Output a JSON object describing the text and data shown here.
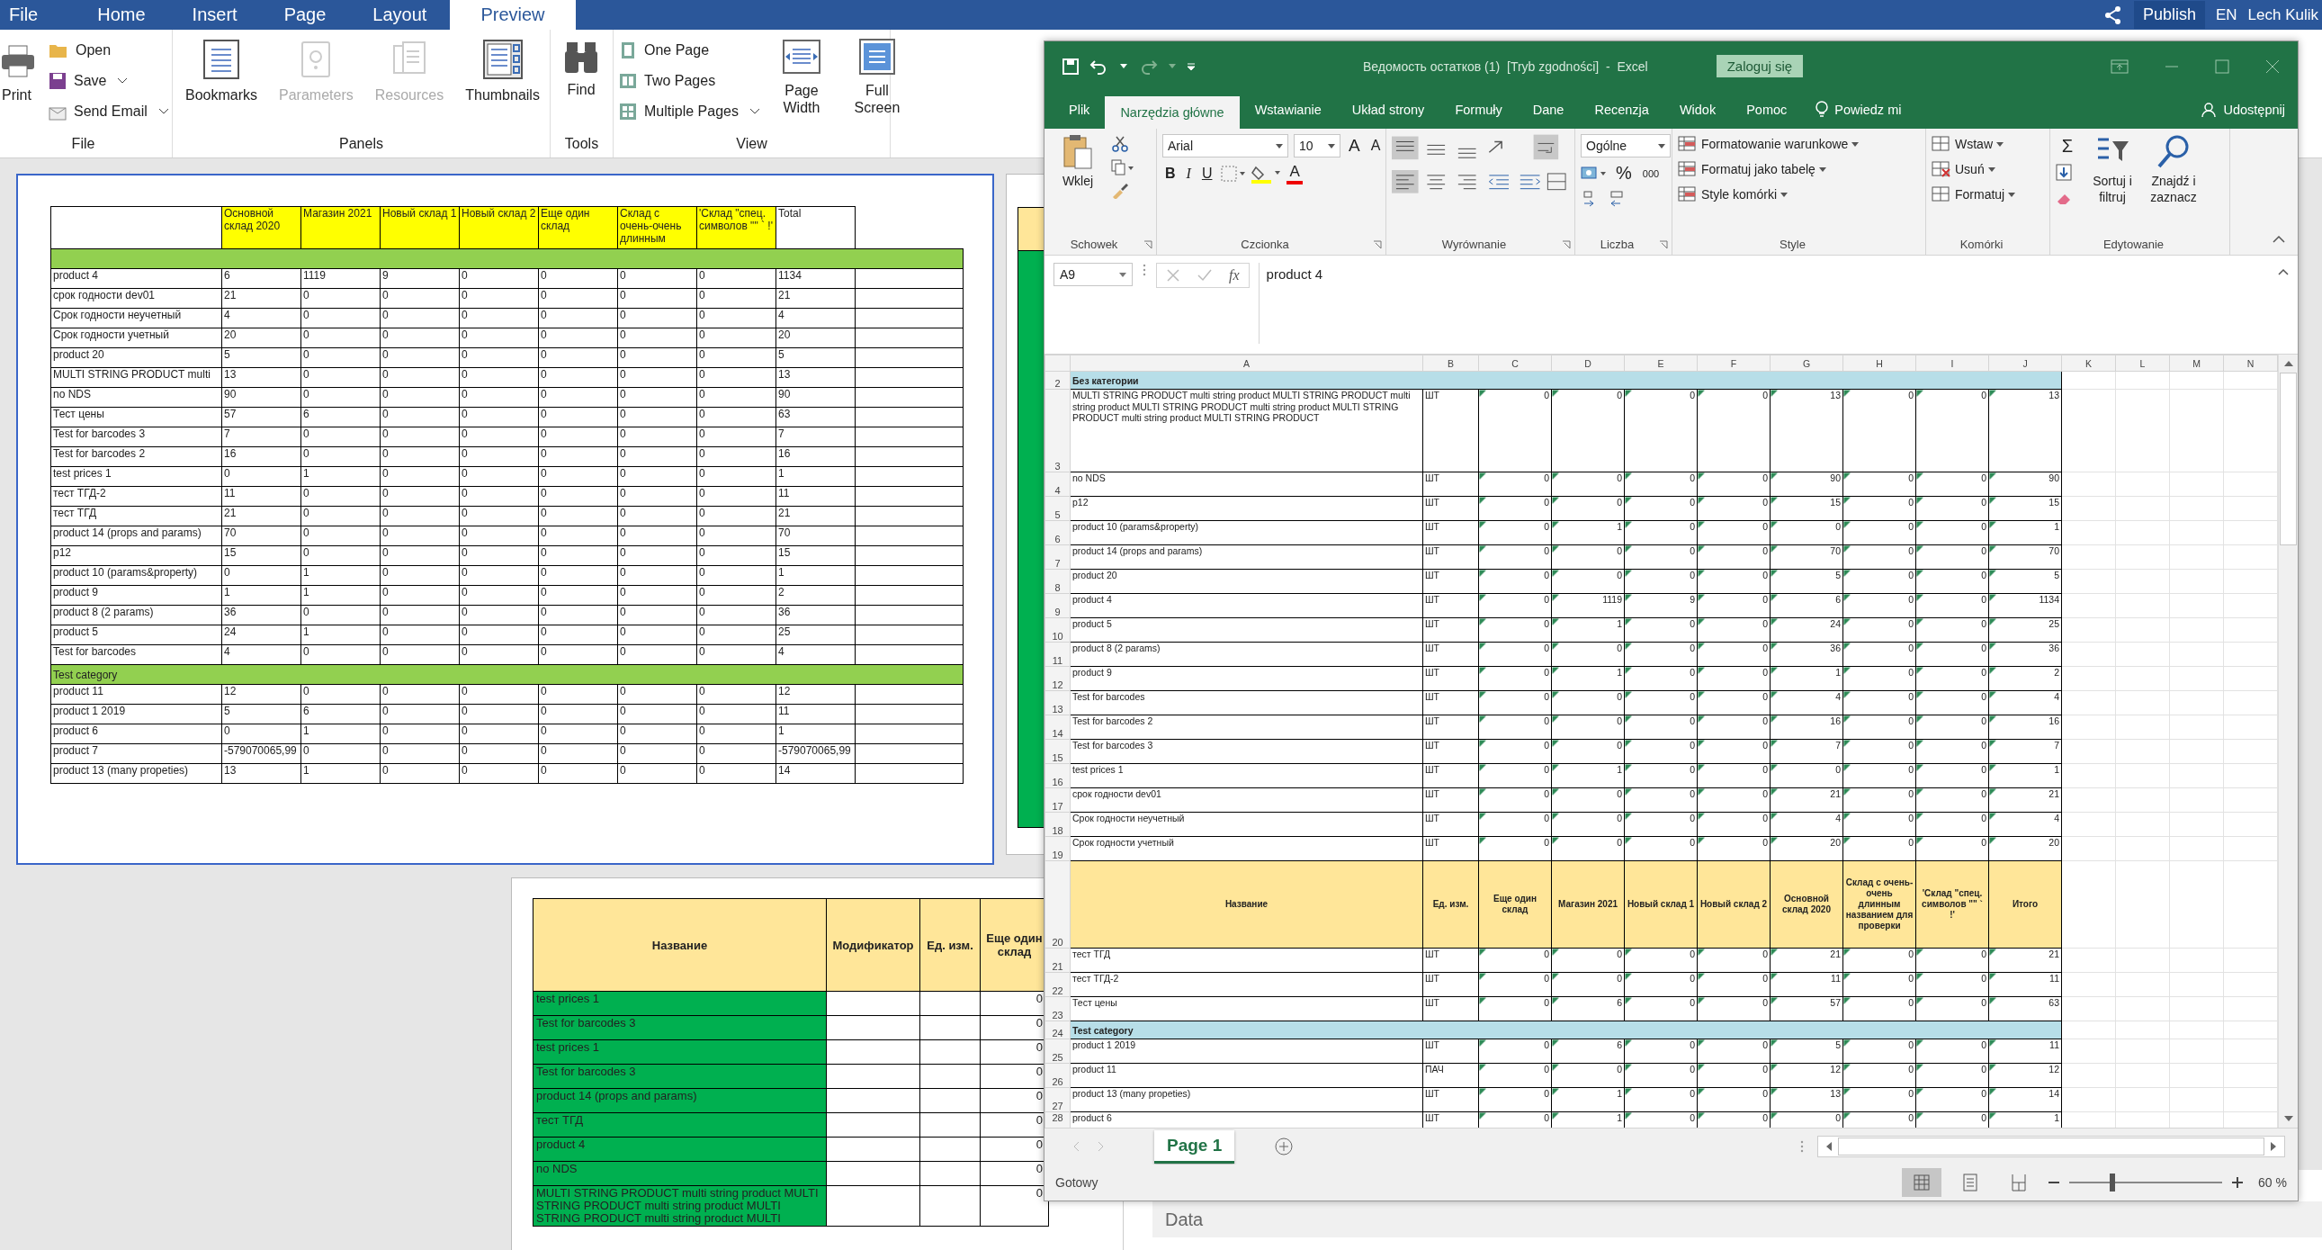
{
  "viewer": {
    "tabs": [
      {
        "label": "File",
        "selected": false
      },
      {
        "label": "Home",
        "selected": false
      },
      {
        "label": "Insert",
        "selected": false
      },
      {
        "label": "Page",
        "selected": false
      },
      {
        "label": "Layout",
        "selected": false
      },
      {
        "label": "Preview",
        "selected": true
      }
    ],
    "publish": "Publish",
    "language": "EN",
    "user": "Lech Kulik",
    "ribbon": {
      "file": {
        "title": "File",
        "print": "Print",
        "open": "Open",
        "save": "Save",
        "send_email": "Send Email"
      },
      "panels": {
        "title": "Panels",
        "items": [
          {
            "label": "Bookmarks",
            "disabled": false
          },
          {
            "label": "Parameters",
            "disabled": true
          },
          {
            "label": "Resources",
            "disabled": true
          },
          {
            "label": "Thumbnails",
            "disabled": false
          }
        ]
      },
      "tools": {
        "title": "Tools",
        "find": "Find"
      },
      "view": {
        "title": "View",
        "one_page": "One Page",
        "two_pages": "Two Pages",
        "multiple_pages": "Multiple Pages",
        "page_width": "Page Width",
        "full_screen": "Full Screen"
      }
    }
  },
  "report_page": {
    "columns": [
      "Основной склад 2020",
      "Магазин 2021",
      "Новый склад 1",
      "Новый склад 2",
      "Еще один склад",
      "Склад с очень-очень длинным",
      "'Склад \"спец. символов \"\" ` !'",
      "Total"
    ],
    "groups": [
      {
        "rows": [
          {
            "name": "product 4",
            "values": [
              "6",
              "1119",
              "9",
              "0",
              "0",
              "0",
              "0",
              "1134"
            ]
          },
          {
            "name": "срок годности dev01",
            "values": [
              "21",
              "0",
              "0",
              "0",
              "0",
              "0",
              "0",
              "21"
            ]
          },
          {
            "name": "Срок годности неучетный",
            "values": [
              "4",
              "0",
              "0",
              "0",
              "0",
              "0",
              "0",
              "4"
            ]
          },
          {
            "name": "Срок годности учетный",
            "values": [
              "20",
              "0",
              "0",
              "0",
              "0",
              "0",
              "0",
              "20"
            ]
          },
          {
            "name": "product 20",
            "values": [
              "5",
              "0",
              "0",
              "0",
              "0",
              "0",
              "0",
              "5"
            ]
          },
          {
            "name": "MULTI  STRING  PRODUCT  multi",
            "values": [
              "13",
              "0",
              "0",
              "0",
              "0",
              "0",
              "0",
              "13"
            ]
          },
          {
            "name": "no NDS",
            "values": [
              "90",
              "0",
              "0",
              "0",
              "0",
              "0",
              "0",
              "90"
            ]
          },
          {
            "name": "Тест цены",
            "values": [
              "57",
              "6",
              "0",
              "0",
              "0",
              "0",
              "0",
              "63"
            ]
          },
          {
            "name": "Test for barcodes 3",
            "values": [
              "7",
              "0",
              "0",
              "0",
              "0",
              "0",
              "0",
              "7"
            ]
          },
          {
            "name": "Test for barcodes 2",
            "values": [
              "16",
              "0",
              "0",
              "0",
              "0",
              "0",
              "0",
              "16"
            ]
          },
          {
            "name": "test prices 1",
            "values": [
              "0",
              "1",
              "0",
              "0",
              "0",
              "0",
              "0",
              "1"
            ]
          },
          {
            "name": "тест ТГД-2",
            "values": [
              "11",
              "0",
              "0",
              "0",
              "0",
              "0",
              "0",
              "11"
            ]
          },
          {
            "name": "тест ТГД",
            "values": [
              "21",
              "0",
              "0",
              "0",
              "0",
              "0",
              "0",
              "21"
            ]
          },
          {
            "name": "product 14 (props and params)",
            "values": [
              "70",
              "0",
              "0",
              "0",
              "0",
              "0",
              "0",
              "70"
            ]
          },
          {
            "name": "p12",
            "values": [
              "15",
              "0",
              "0",
              "0",
              "0",
              "0",
              "0",
              "15"
            ]
          },
          {
            "name": "product 10 (params&property)",
            "values": [
              "0",
              "1",
              "0",
              "0",
              "0",
              "0",
              "0",
              "1"
            ]
          },
          {
            "name": "product 9",
            "values": [
              "1",
              "1",
              "0",
              "0",
              "0",
              "0",
              "0",
              "2"
            ]
          },
          {
            "name": "product 8 (2 params)",
            "values": [
              "36",
              "0",
              "0",
              "0",
              "0",
              "0",
              "0",
              "36"
            ]
          },
          {
            "name": "product 5",
            "values": [
              "24",
              "1",
              "0",
              "0",
              "0",
              "0",
              "0",
              "25"
            ]
          },
          {
            "name": "Test for barcodes",
            "values": [
              "4",
              "0",
              "0",
              "0",
              "0",
              "0",
              "0",
              "4"
            ]
          }
        ]
      },
      {
        "title": "Test category",
        "rows": [
          {
            "name": "product 11",
            "values": [
              "12",
              "0",
              "0",
              "0",
              "0",
              "0",
              "0",
              "12"
            ]
          },
          {
            "name": "product 1 2019",
            "values": [
              "5",
              "6",
              "0",
              "0",
              "0",
              "0",
              "0",
              "11"
            ]
          },
          {
            "name": "product 6",
            "values": [
              "0",
              "1",
              "0",
              "0",
              "0",
              "0",
              "0",
              "1"
            ]
          },
          {
            "name": "product 7",
            "values": [
              "-579070065,99",
              "0",
              "0",
              "0",
              "0",
              "0",
              "0",
              "-579070065,99"
            ]
          },
          {
            "name": "product 13 (many propeties)",
            "values": [
              "13",
              "1",
              "0",
              "0",
              "0",
              "0",
              "0",
              "14"
            ]
          }
        ]
      }
    ]
  },
  "lower_page": {
    "columns": [
      "Название",
      "Модификатор",
      "Ед. изм.",
      "Еще один склад"
    ],
    "rows": [
      {
        "name": "test prices 1",
        "value": "0"
      },
      {
        "name": "Test for barcodes 3",
        "value": "0"
      },
      {
        "name": "test prices 1",
        "value": "0"
      },
      {
        "name": "Test for barcodes 3",
        "value": "0"
      },
      {
        "name": "product 14 (props and params)",
        "value": "0"
      },
      {
        "name": "тест ТГД",
        "value": "0"
      },
      {
        "name": "product 4",
        "value": "0"
      },
      {
        "name": "no NDS",
        "value": "0"
      },
      {
        "name": "MULTI STRING PRODUCT multi string product MULTI STRING PRODUCT multi string product MULTI STRING PRODUCT multi string product MULTI",
        "value": "0"
      }
    ]
  },
  "excel": {
    "title": "Ведомость остатков (1)  [Tryb zgodności]  -  Excel",
    "sign_in": "Zaloguj się",
    "tabs": [
      {
        "label": "Plik",
        "selected": false
      },
      {
        "label": "Narzędzia główne",
        "selected": true
      },
      {
        "label": "Wstawianie",
        "selected": false
      },
      {
        "label": "Układ strony",
        "selected": false
      },
      {
        "label": "Formuły",
        "selected": false
      },
      {
        "label": "Dane",
        "selected": false
      },
      {
        "label": "Recenzja",
        "selected": false
      },
      {
        "label": "Widok",
        "selected": false
      },
      {
        "label": "Pomoc",
        "selected": false
      }
    ],
    "tell_me": "Powiedz mi",
    "share": "Udostępnij",
    "ribbon": {
      "clipboard": {
        "title": "Schowek",
        "paste": "Wklej"
      },
      "font": {
        "title": "Czcionka",
        "name": "Arial",
        "size": "10",
        "grow": "A",
        "shrink": "A",
        "bold": "B",
        "italic": "I",
        "underline": "U",
        "font_color_button": "A"
      },
      "alignment": {
        "title": "Wyrównanie"
      },
      "number": {
        "title": "Liczba",
        "format": "Ogólne",
        "percent": "%",
        "thousands": "000"
      },
      "styles": {
        "title": "Style",
        "items": [
          "Formatowanie warunkowe",
          "Formatuj jako tabelę",
          "Style komórki"
        ]
      },
      "cells": {
        "title": "Komórki",
        "items": [
          "Wstaw",
          "Usuń",
          "Formatuj"
        ]
      },
      "editing": {
        "title": "Edytowanie",
        "sum": "Σ",
        "sort": "Sortuj i filtruj",
        "find": "Znajdź i zaznacz"
      }
    },
    "name_box": "A9",
    "fx": "fx",
    "formula": "product 4",
    "columns": [
      "A",
      "B",
      "C",
      "D",
      "E",
      "F",
      "G",
      "H",
      "I",
      "J",
      "K",
      "L",
      "M",
      "N"
    ],
    "rows": [
      {
        "kind": "category",
        "number": "2",
        "label": "Без категории"
      },
      {
        "kind": "item",
        "number": "3",
        "tall": true,
        "name": "MULTI STRING PRODUCT multi string product MULTI STRING PRODUCT multi string product MULTI STRING PRODUCT multi string product MULTI STRING PRODUCT multi string product MULTI STRING PRODUCT",
        "unit": "ШТ",
        "values": [
          "0",
          "0",
          "0",
          "0",
          "13",
          "0",
          "0",
          "13"
        ]
      },
      {
        "kind": "item",
        "number": "4",
        "name": "no NDS",
        "unit": "ШТ",
        "values": [
          "0",
          "0",
          "0",
          "0",
          "90",
          "0",
          "0",
          "90"
        ]
      },
      {
        "kind": "item",
        "number": "5",
        "name": "p12",
        "unit": "ШТ",
        "values": [
          "0",
          "0",
          "0",
          "0",
          "15",
          "0",
          "0",
          "15"
        ]
      },
      {
        "kind": "item",
        "number": "6",
        "name": "product 10 (params&property)",
        "unit": "ШТ",
        "values": [
          "0",
          "1",
          "0",
          "0",
          "0",
          "0",
          "0",
          "1"
        ]
      },
      {
        "kind": "item",
        "number": "7",
        "name": "product 14 (props and params)",
        "unit": "ШТ",
        "values": [
          "0",
          "0",
          "0",
          "0",
          "70",
          "0",
          "0",
          "70"
        ]
      },
      {
        "kind": "item",
        "number": "8",
        "name": "product 20",
        "unit": "ШТ",
        "values": [
          "0",
          "0",
          "0",
          "0",
          "5",
          "0",
          "0",
          "5"
        ]
      },
      {
        "kind": "item",
        "number": "9",
        "name": "product 4",
        "unit": "ШТ",
        "values": [
          "0",
          "1119",
          "9",
          "0",
          "6",
          "0",
          "0",
          "1134"
        ]
      },
      {
        "kind": "item",
        "number": "10",
        "name": "product 5",
        "unit": "ШТ",
        "values": [
          "0",
          "1",
          "0",
          "0",
          "24",
          "0",
          "0",
          "25"
        ]
      },
      {
        "kind": "item",
        "number": "11",
        "name": "product 8 (2 params)",
        "unit": "ШТ",
        "values": [
          "0",
          "0",
          "0",
          "0",
          "36",
          "0",
          "0",
          "36"
        ]
      },
      {
        "kind": "item",
        "number": "12",
        "name": "product 9",
        "unit": "ШТ",
        "values": [
          "0",
          "1",
          "0",
          "0",
          "1",
          "0",
          "0",
          "2"
        ]
      },
      {
        "kind": "item",
        "number": "13",
        "name": "Test for barcodes",
        "unit": "ШТ",
        "values": [
          "0",
          "0",
          "0",
          "0",
          "4",
          "0",
          "0",
          "4"
        ]
      },
      {
        "kind": "item",
        "number": "14",
        "name": "Test for barcodes 2",
        "unit": "ШТ",
        "values": [
          "0",
          "0",
          "0",
          "0",
          "16",
          "0",
          "0",
          "16"
        ]
      },
      {
        "kind": "item",
        "number": "15",
        "name": "Test for barcodes 3",
        "unit": "ШТ",
        "values": [
          "0",
          "0",
          "0",
          "0",
          "7",
          "0",
          "0",
          "7"
        ]
      },
      {
        "kind": "item",
        "number": "16",
        "name": "test prices 1",
        "unit": "ШТ",
        "values": [
          "0",
          "1",
          "0",
          "0",
          "0",
          "0",
          "0",
          "1"
        ]
      },
      {
        "kind": "item",
        "number": "17",
        "name": "срок годности dev01",
        "unit": "ШТ",
        "values": [
          "0",
          "0",
          "0",
          "0",
          "21",
          "0",
          "0",
          "21"
        ]
      },
      {
        "kind": "item",
        "number": "18",
        "name": "Срок годности неучетный",
        "unit": "ШТ",
        "values": [
          "0",
          "0",
          "0",
          "0",
          "4",
          "0",
          "0",
          "4"
        ]
      },
      {
        "kind": "item",
        "number": "19",
        "name": "Срок годности учетный",
        "unit": "ШТ",
        "values": [
          "0",
          "0",
          "0",
          "0",
          "20",
          "0",
          "0",
          "20"
        ]
      },
      {
        "kind": "header",
        "number": "20",
        "labels": [
          "Название",
          "Ед. изм.",
          "Еще один склад",
          "Магазин 2021",
          "Новый склад 1",
          "Новый склад 2",
          "Основной склад 2020",
          "Склад с очень-очень длинным названием для проверки",
          "'Склад \"спец. символов \"\" ` !'",
          "Итого"
        ]
      },
      {
        "kind": "item",
        "number": "21",
        "name": "тест ТГД",
        "unit": "ШТ",
        "values": [
          "0",
          "0",
          "0",
          "0",
          "21",
          "0",
          "0",
          "21"
        ]
      },
      {
        "kind": "item",
        "number": "22",
        "name": "тест ТГД-2",
        "unit": "ШТ",
        "values": [
          "0",
          "0",
          "0",
          "0",
          "11",
          "0",
          "0",
          "11"
        ]
      },
      {
        "kind": "item",
        "number": "23",
        "name": "Тест цены",
        "unit": "ШТ",
        "values": [
          "0",
          "6",
          "0",
          "0",
          "57",
          "0",
          "0",
          "63"
        ]
      },
      {
        "kind": "category",
        "number": "24",
        "label": "Test category"
      },
      {
        "kind": "item",
        "number": "25",
        "name": "product 1 2019",
        "unit": "ШТ",
        "values": [
          "0",
          "6",
          "0",
          "0",
          "5",
          "0",
          "0",
          "11"
        ]
      },
      {
        "kind": "item",
        "number": "26",
        "name": "product 11",
        "unit": "ПАЧ",
        "values": [
          "0",
          "0",
          "0",
          "0",
          "12",
          "0",
          "0",
          "12"
        ]
      },
      {
        "kind": "item",
        "number": "27",
        "name": "product 13 (many propeties)",
        "unit": "ШТ",
        "values": [
          "0",
          "1",
          "0",
          "0",
          "13",
          "0",
          "0",
          "14"
        ]
      },
      {
        "kind": "item",
        "number": "28",
        "name": "product 6",
        "unit": "ШТ",
        "values": [
          "0",
          "1",
          "0",
          "0",
          "0",
          "0",
          "0",
          "1"
        ]
      }
    ],
    "sheets": [
      {
        "label": "Page 1",
        "selected": true
      }
    ],
    "status": "Gotowy",
    "zoom": {
      "level": 0.28,
      "label": "60 %"
    }
  },
  "data_window": {
    "title": "Data"
  }
}
